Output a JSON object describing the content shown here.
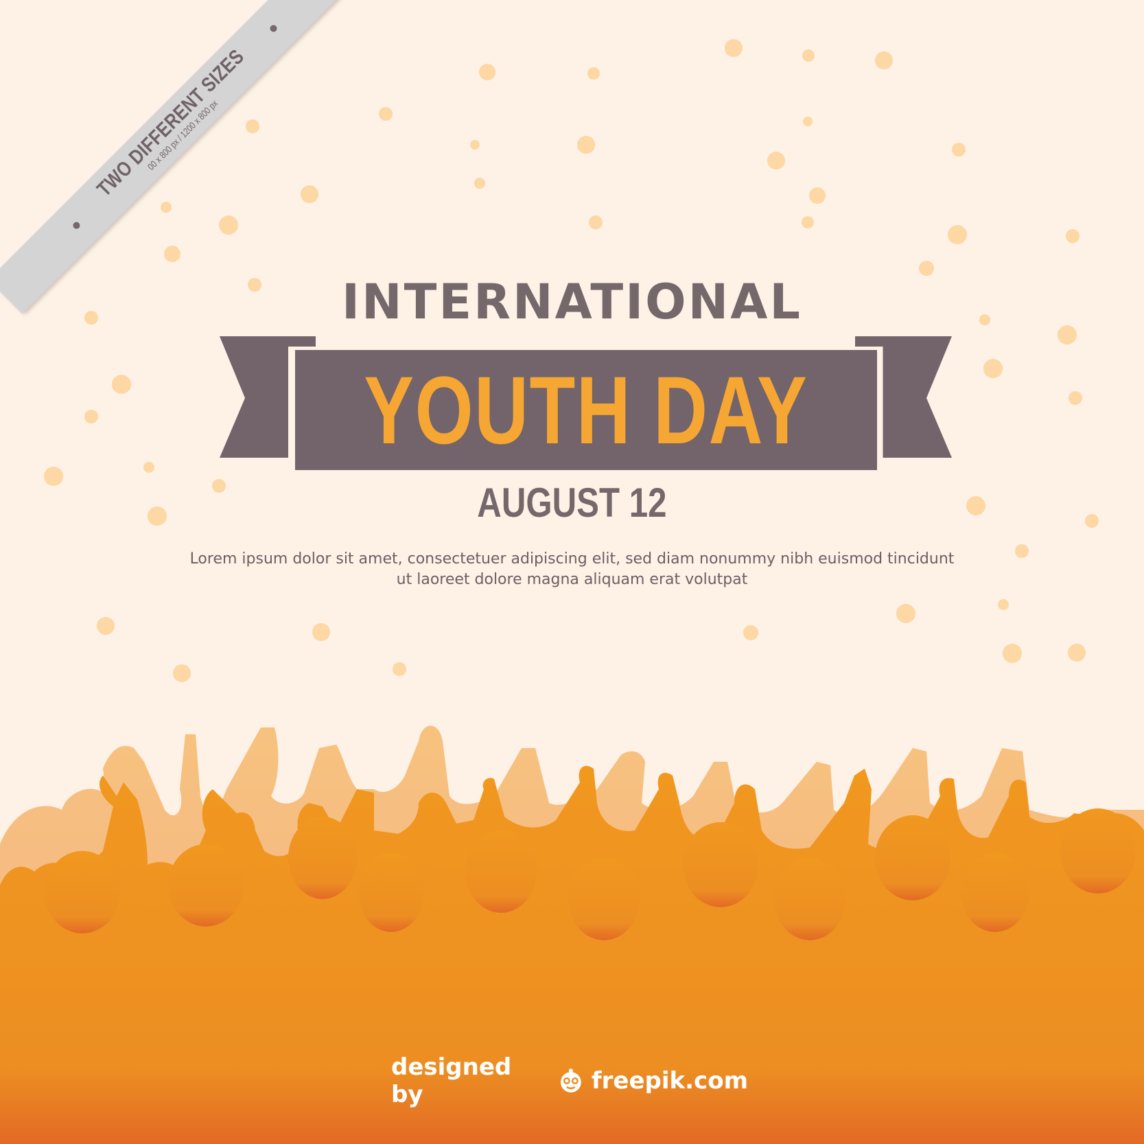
{
  "corner_banner": {
    "title": "TWO DIFFERENT SIZES",
    "subtitle": "00 x 800 px / 1200 x 800 px"
  },
  "poster": {
    "line1": "INTERNATIONAL",
    "line2": "YOUTH DAY",
    "date": "AUGUST 12",
    "body_line1": "Lorem ipsum dolor sit amet, consectetuer adipiscing elit, sed diam nonummy nibh euismod tincidunt",
    "body_line2": "ut laoreet dolore magna aliquam erat volutpat"
  },
  "credit": {
    "prefix": "designed by",
    "brand": "freepik.com",
    "icon": "freepik-logo-icon"
  },
  "colors": {
    "background": "#fef1e6",
    "ribbon": "#72646a",
    "accent": "#f6a633",
    "text": "#75686b",
    "dots": "#fdd7a4",
    "crowd_front": "#ec9020",
    "crowd_back": "#f6c487"
  }
}
